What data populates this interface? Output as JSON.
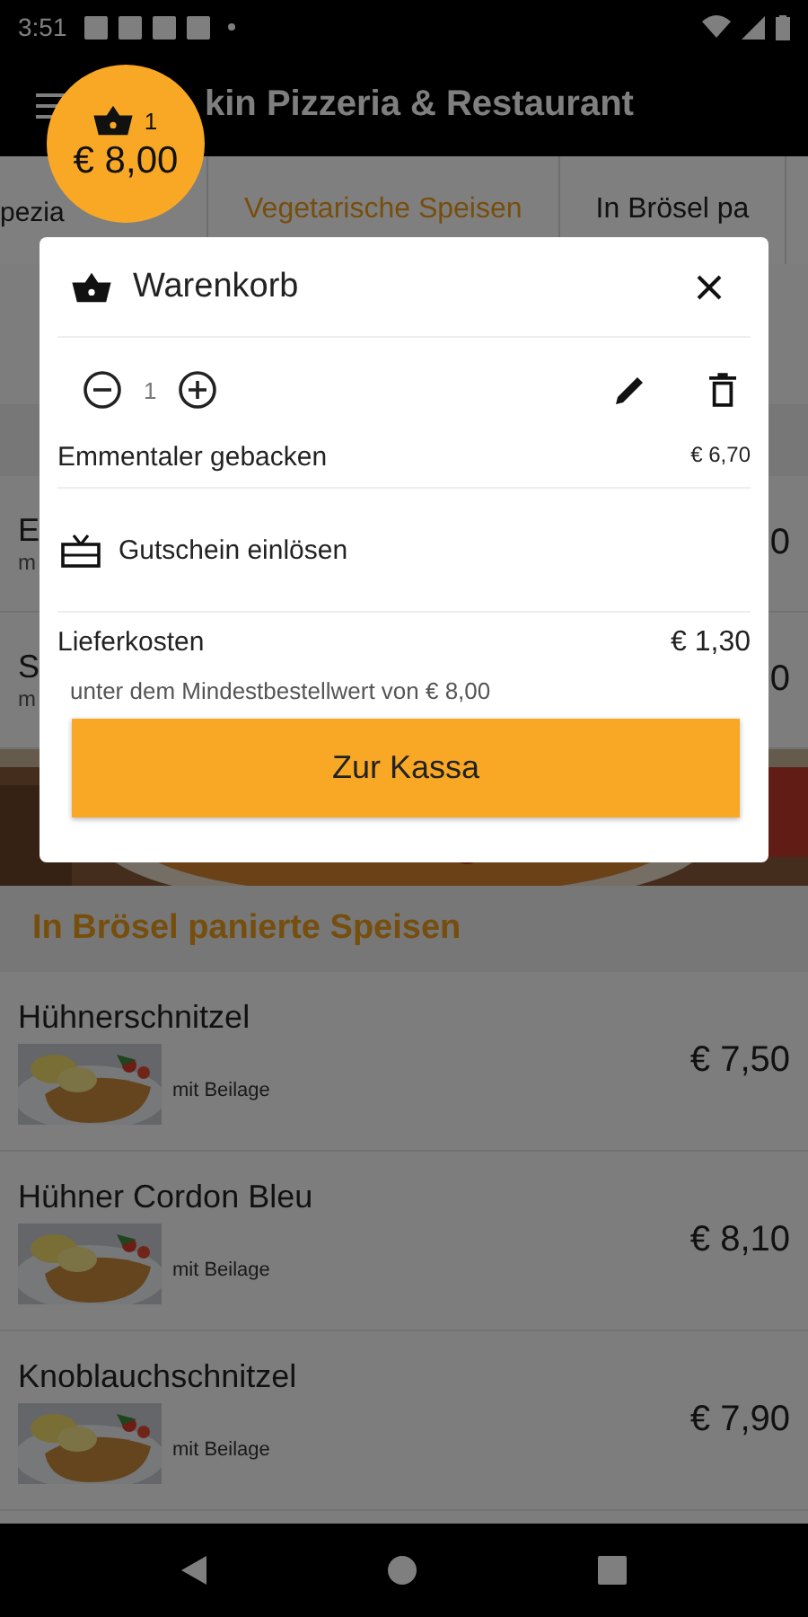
{
  "status_bar": {
    "time": "3:51"
  },
  "app_bar": {
    "title": "kin Pizzeria & Restaurant"
  },
  "cart_badge": {
    "count": "1",
    "total": "€ 8,00"
  },
  "tabs": [
    {
      "label": "pezia",
      "selected": false
    },
    {
      "label": "Vegetarische Speisen",
      "selected": true
    },
    {
      "label": "In Brösel pa",
      "selected": false
    }
  ],
  "hidden_section": {
    "items": [
      {
        "name": "E",
        "description": "m",
        "price": "0"
      },
      {
        "name": "S",
        "description": "m",
        "price": "0"
      }
    ]
  },
  "cart_dialog": {
    "title": "Warenkorb",
    "items": [
      {
        "quantity": "1",
        "name": "Emmentaler gebacken",
        "price": "€ 6,70"
      }
    ],
    "voucher_label": "Gutschein einlösen",
    "delivery": {
      "label": "Lieferkosten",
      "price": "€ 1,30"
    },
    "note": "unter dem Mindestbestellwert von € 8,00",
    "checkout_button": "Zur Kassa"
  },
  "menu_section": {
    "title": "In Brösel panierte Speisen",
    "items": [
      {
        "name": "Hühnerschnitzel",
        "description": "mit Beilage",
        "price": "€ 7,50"
      },
      {
        "name": "Hühner Cordon Bleu",
        "description": "mit Beilage",
        "price": "€ 8,10"
      },
      {
        "name": "Knoblauchschnitzel",
        "description": "mit Beilage",
        "price": "€ 7,90"
      }
    ]
  }
}
